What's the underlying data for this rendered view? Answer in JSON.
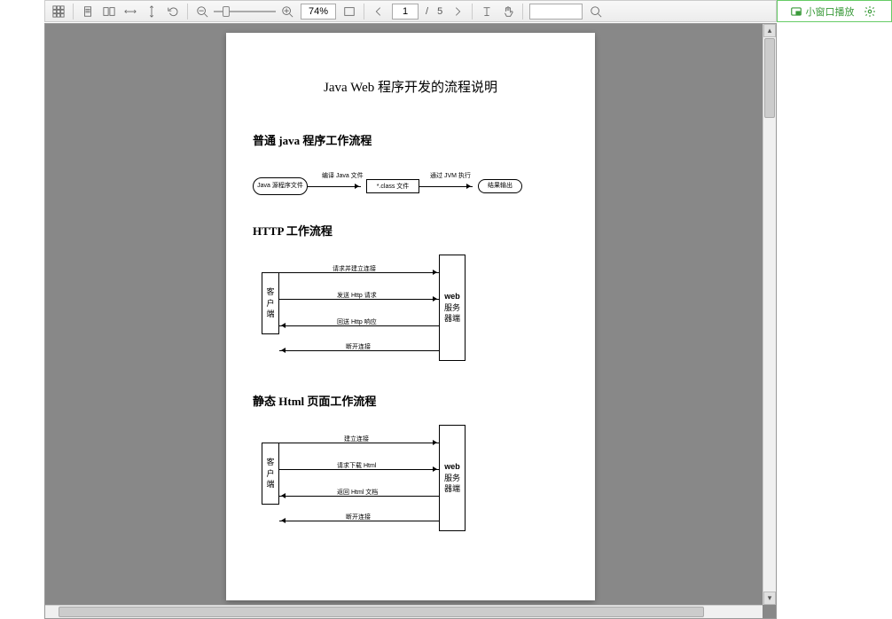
{
  "pip": {
    "label": "小窗口播放"
  },
  "toolbar": {
    "zoom": "74%",
    "current_page": "1",
    "total_pages": "5",
    "page_sep": "/"
  },
  "doc": {
    "title": "Java Web 程序开发的流程说明",
    "section1_title": "普通 java 程序工作流程",
    "section2_title": "HTTP 工作流程",
    "section3_title": "静态 Html 页面工作流程",
    "flow1": {
      "n1": "Java 源程序文件",
      "a1": "编译 Java 文件",
      "n2": "*.class 文件",
      "a2": "通过 JVM 执行",
      "n3": "结果输出"
    },
    "flow2": {
      "left": "客户端",
      "right_top": "web",
      "right": "服务器端",
      "a1": "请求并建立连接",
      "a2": "发送 Http 请求",
      "a3": "回送 Http 响应",
      "a4": "断开连接"
    },
    "flow3": {
      "left": "客户端",
      "right_top": "web",
      "right": "服务器端",
      "a1": "建立连接",
      "a2": "请求下载 Html",
      "a3": "返回 Html 文档",
      "a4": "断开连接"
    }
  }
}
